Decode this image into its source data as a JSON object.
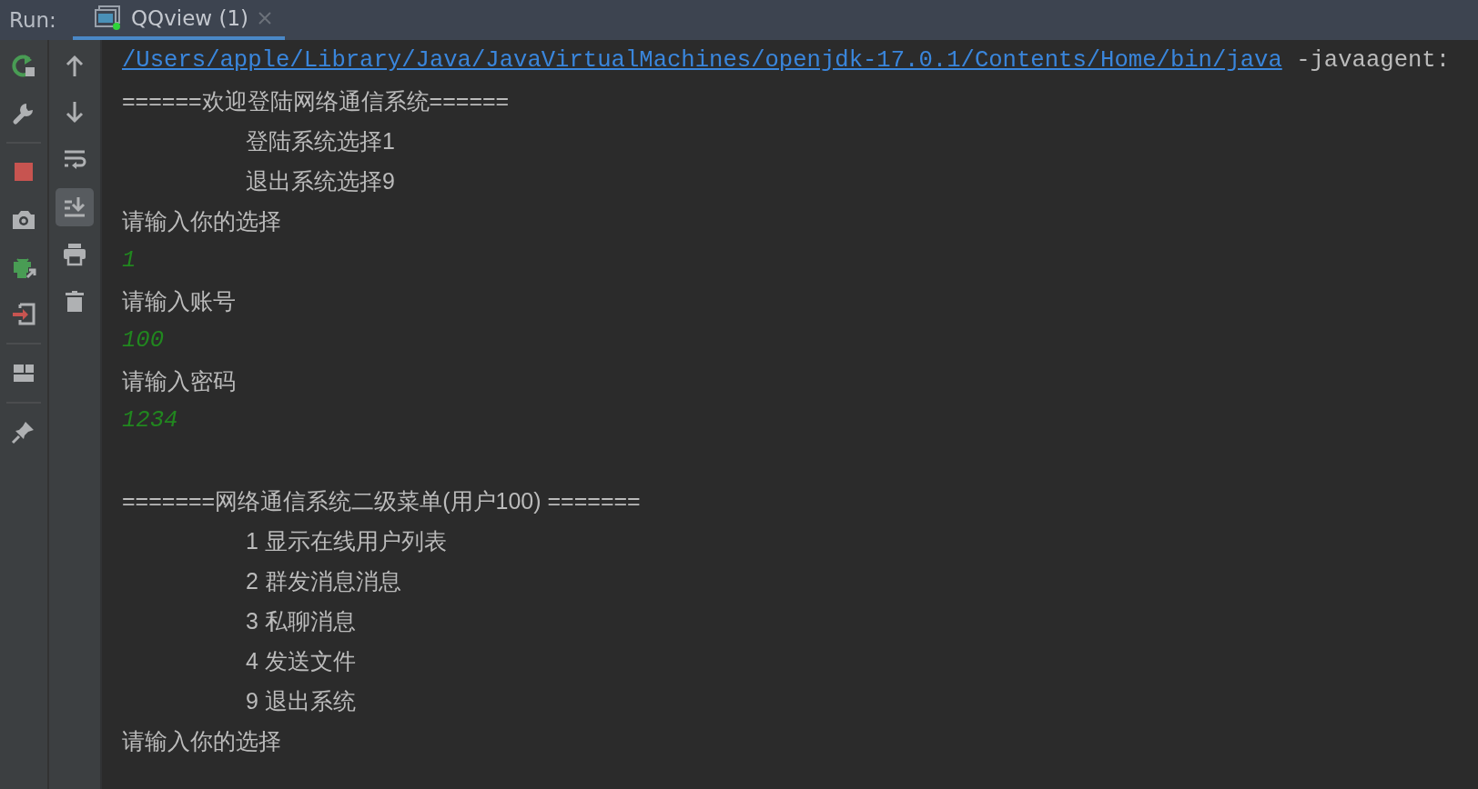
{
  "run_label": "Run:",
  "tabs": [
    {
      "label": "QQview (1)",
      "selected": true,
      "running": true
    }
  ],
  "left_toolbar": [
    {
      "kind": "rerun"
    },
    {
      "kind": "settings"
    },
    {
      "kind": "separator"
    },
    {
      "kind": "stop"
    },
    {
      "kind": "camera"
    },
    {
      "kind": "debug"
    },
    {
      "kind": "exit"
    },
    {
      "kind": "separator"
    },
    {
      "kind": "layout"
    },
    {
      "kind": "separator"
    },
    {
      "kind": "pin"
    }
  ],
  "right_toolbar": [
    {
      "kind": "up",
      "selected": false
    },
    {
      "kind": "down",
      "selected": false
    },
    {
      "kind": "wrap",
      "selected": false
    },
    {
      "kind": "scroll-end",
      "selected": true
    },
    {
      "kind": "print",
      "selected": false
    },
    {
      "kind": "clear",
      "selected": false
    }
  ],
  "console_lines": [
    {
      "kind": "command",
      "path": "/Users/apple/Library/Java/JavaVirtualMachines/openjdk-17.0.1/Contents/Home/bin/java",
      "args": "-javaagent:"
    },
    {
      "kind": "output",
      "text": "======欢迎登陆网络通信系统======"
    },
    {
      "kind": "menu_option",
      "text": "登陆系统选择1"
    },
    {
      "kind": "menu_option",
      "text": "退出系统选择9"
    },
    {
      "kind": "output",
      "text": "请输入你的选择"
    },
    {
      "kind": "input",
      "text": "1"
    },
    {
      "kind": "output",
      "text": "请输入账号"
    },
    {
      "kind": "input",
      "text": "100"
    },
    {
      "kind": "output",
      "text": "请输入密码"
    },
    {
      "kind": "input",
      "text": "1234"
    },
    {
      "kind": "blank"
    },
    {
      "kind": "output",
      "text": "=======网络通信系统二级菜单(用户100) ======="
    },
    {
      "kind": "menu_option",
      "text": "1 显示在线用户列表"
    },
    {
      "kind": "menu_option",
      "text": "2 群发消息消息"
    },
    {
      "kind": "menu_option",
      "text": "3 私聊消息"
    },
    {
      "kind": "menu_option",
      "text": "4 发送文件"
    },
    {
      "kind": "menu_option",
      "text": "9 退出系统"
    },
    {
      "kind": "output",
      "text": "请输入你的选择"
    }
  ]
}
